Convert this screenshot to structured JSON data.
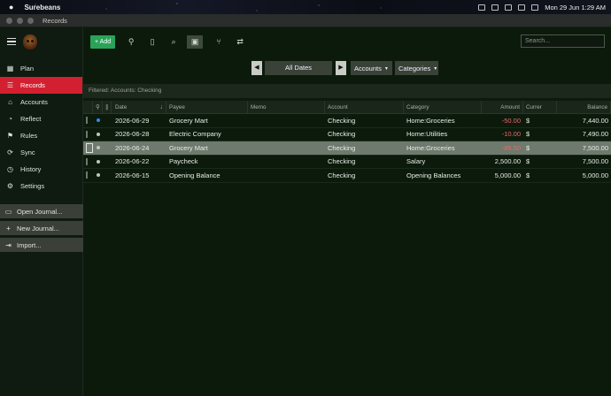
{
  "menubar": {
    "app_name": "Surebeans",
    "datetime": "Mon 29 Jun   1:29 AM"
  },
  "window": {
    "title": "Records"
  },
  "sidebar": {
    "items": [
      {
        "label": "Plan",
        "icon": "calendar-icon",
        "active": false
      },
      {
        "label": "Records",
        "icon": "list-icon",
        "active": true
      },
      {
        "label": "Accounts",
        "icon": "bank-icon",
        "active": false
      },
      {
        "label": "Reflect",
        "icon": "chart-icon",
        "active": false
      },
      {
        "label": "Rules",
        "icon": "rules-icon",
        "active": false
      },
      {
        "label": "Sync",
        "icon": "sync-icon",
        "active": false
      },
      {
        "label": "History",
        "icon": "history-icon",
        "active": false
      },
      {
        "label": "Settings",
        "icon": "gear-icon",
        "active": false
      }
    ],
    "actions": [
      {
        "label": "Open Journal...",
        "icon": "folder-icon"
      },
      {
        "label": "New Journal...",
        "icon": "plus-icon"
      },
      {
        "label": "Import...",
        "icon": "import-icon"
      }
    ]
  },
  "toolbar": {
    "add_label": "+ Add",
    "search_placeholder": "Search..."
  },
  "filters": {
    "prev": "◀",
    "date": "All Dates",
    "next": "▶",
    "accounts": "Accounts",
    "categories": "Categories"
  },
  "filter_banner": "Filtered: Accounts: Checking",
  "table": {
    "headers": [
      "",
      "",
      "",
      "Date",
      "Payee",
      "Memo",
      "Account",
      "Category",
      "Amount",
      "Currer",
      "Balance"
    ],
    "rows": [
      {
        "date": "2026-06-29",
        "payee": "Grocery Mart",
        "memo": "",
        "account": "Checking",
        "category": "Home:Groceries",
        "amount": "-50.00",
        "currency": "$",
        "balance": "7,440.00",
        "negative": true,
        "status": "blue",
        "selected": false
      },
      {
        "date": "2026-06-28",
        "payee": "Electric Company",
        "memo": "",
        "account": "Checking",
        "category": "Home:Utilities",
        "amount": "-10.00",
        "currency": "$",
        "balance": "7,490.00",
        "negative": true,
        "status": "grey",
        "selected": false
      },
      {
        "date": "2026-06-24",
        "payee": "Grocery Mart",
        "memo": "",
        "account": "Checking",
        "category": "Home:Groceries",
        "amount": "-85.50",
        "currency": "$",
        "balance": "7,500.00",
        "negative": true,
        "status": "grey",
        "selected": true
      },
      {
        "date": "2026-06-22",
        "payee": "Paycheck",
        "memo": "",
        "account": "Checking",
        "category": "Salary",
        "amount": "2,500.00",
        "currency": "$",
        "balance": "7,500.00",
        "negative": false,
        "status": "grey",
        "selected": false
      },
      {
        "date": "2026-06-15",
        "payee": "Opening Balance",
        "memo": "",
        "account": "Checking",
        "category": "Opening Balances",
        "amount": "5,000.00",
        "currency": "$",
        "balance": "5,000.00",
        "negative": false,
        "status": "grey",
        "selected": false
      }
    ]
  },
  "colors": {
    "accent_red": "#d32030",
    "add_green": "#2aa35a",
    "negative_amount": "#e86a6a",
    "status_blue": "#2f8fe8"
  }
}
